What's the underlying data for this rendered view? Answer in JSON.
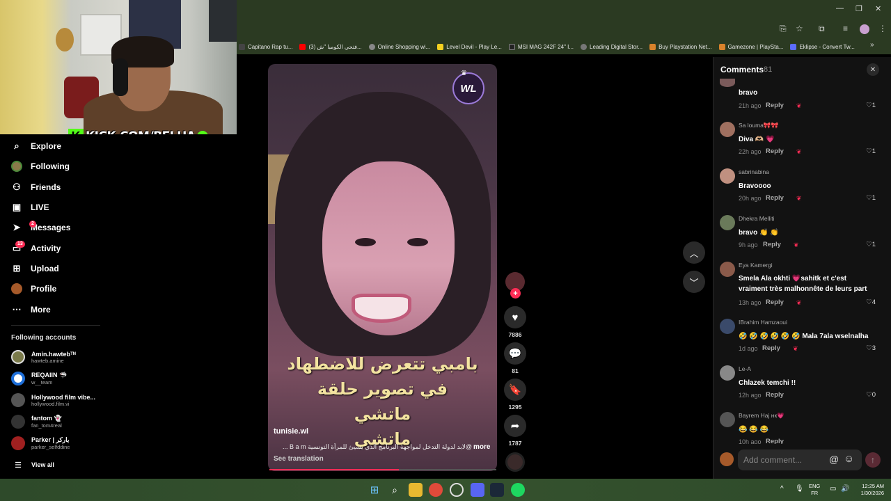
{
  "bookmarks": [
    {
      "label": "Capitano Rap tu...",
      "color": "#444"
    },
    {
      "label": "(3) فتحي الكومبا \"ش...",
      "color": "#ff0000"
    },
    {
      "label": "Online Shopping wi...",
      "color": "#888"
    },
    {
      "label": "Level Devil - Play Le...",
      "color": "#f5d020"
    },
    {
      "label": "MSI MAG 242F 24\" I...",
      "color": "#222"
    },
    {
      "label": "Leading Digital Stor...",
      "color": "#777"
    },
    {
      "label": "Buy Playstation Net...",
      "color": "#d9822b"
    },
    {
      "label": "Gamezone | PlaySta...",
      "color": "#d9822b"
    },
    {
      "label": "Eklipse - Convert Tw...",
      "color": "#5b6cff"
    }
  ],
  "webcam": {
    "overlay_text": "KICK.COM/BELHA",
    "k_letter": "K",
    "check": "✔"
  },
  "nav": [
    {
      "label": "Explore",
      "icon": "⌕",
      "badge": ""
    },
    {
      "label": "Following",
      "icon": "◍",
      "badge": ""
    },
    {
      "label": "Friends",
      "icon": "👥",
      "badge": ""
    },
    {
      "label": "LIVE",
      "icon": "▶",
      "badge": ""
    },
    {
      "label": "Messages",
      "icon": "➤",
      "badge": "2"
    },
    {
      "label": "Activity",
      "icon": "▣",
      "badge": "13"
    },
    {
      "label": "Upload",
      "icon": "⊞",
      "badge": ""
    },
    {
      "label": "Profile",
      "icon": "●",
      "badge": ""
    },
    {
      "label": "More",
      "icon": "⋯",
      "badge": ""
    }
  ],
  "following_title": "Following accounts",
  "accounts": [
    {
      "name": "Amin.hawtebᵀᴺ",
      "handle": "hawteb.amine",
      "color": "#7a7a4a"
    },
    {
      "name": "REQAIIN 🦈",
      "handle": "w__team",
      "color": "#1e6fd9"
    },
    {
      "name": "Hollywood film vibe...",
      "handle": "hollywood.film.vi",
      "color": "#555"
    },
    {
      "name": "fantom 👻",
      "handle": "fan_tom4real",
      "color": "#333"
    },
    {
      "name": "Parker | باركر",
      "handle": "parker_selfddine",
      "color": "#a02020"
    }
  ],
  "view_all": "View all",
  "video": {
    "watermark": "WL",
    "caption_lines": [
      "بامبي تتعرض للاضطهاد",
      "في تصوير حلقة",
      "ماتشي",
      "ماتشي"
    ],
    "author": "tunisie.wl",
    "description": "@لابد لدولة التدخل لمواجهة البرنامج الذي يسيئ للمرأة التونسية B a m ...",
    "more": "more",
    "see_translation": "See translation",
    "progress": 0.57
  },
  "actions": {
    "likes": "7886",
    "comments": "81",
    "saves": "1295",
    "shares": "1787"
  },
  "comments_panel": {
    "title": "Comments",
    "count": "81",
    "close": "✕",
    "reply_label": "Reply",
    "items": [
      {
        "user": "",
        "text": "bravo",
        "time": "21h ago",
        "likes": "1",
        "color": "#7a5a5a"
      },
      {
        "user": "Sa louma🎀🎀",
        "text": "Diva 🫶🏼 💗",
        "time": "22h ago",
        "likes": "1",
        "color": "#a07060"
      },
      {
        "user": "sabrinabina",
        "text": "Bravoooo",
        "time": "20h ago",
        "likes": "1",
        "color": "#c09080"
      },
      {
        "user": "Dhekra Melliti",
        "text": "bravo 👏 👏",
        "time": "9h ago",
        "likes": "1",
        "color": "#6a7a5a"
      },
      {
        "user": "Eya Kamergi",
        "text": "Smela Ala okhti 💗sahitk et c'est vraiment très malhonnête de leurs part",
        "time": "13h ago",
        "likes": "4",
        "color": "#8a5a4a"
      },
      {
        "user": "IBrahim Hamzaoui",
        "text": "🤣 🤣 🤣 🤣 🤣 🤣 Mala 7ala wselnalha",
        "time": "1d ago",
        "likes": "3",
        "color": "#3a4a6a"
      },
      {
        "user": "Le-A",
        "text": "Chlazek temchi !!",
        "time": "12h ago",
        "likes": "0",
        "color": "#888"
      },
      {
        "user": "Bayrem Haj нк💗",
        "text": "😂 😂 😂",
        "time": "10h ago",
        "likes": "",
        "color": "#555"
      }
    ],
    "add_placeholder": "Add comment..."
  },
  "tray": {
    "lang1": "ENG",
    "lang2": "FR",
    "time": "12:25 AM",
    "date": "1/30/2026"
  }
}
